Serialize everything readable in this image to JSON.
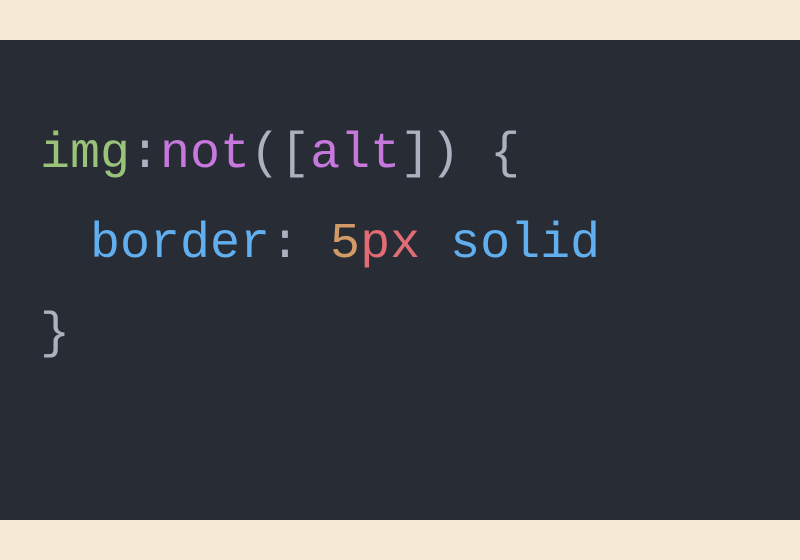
{
  "code": {
    "line1": {
      "selector_tag": "img",
      "colon": ":",
      "pseudo": "not",
      "paren_open": "(",
      "bracket_open": "[",
      "attr": "alt",
      "bracket_close": "]",
      "paren_close": ")",
      "space_brace": " {",
      "brace_open": "{"
    },
    "line2": {
      "property": "border",
      "colon_space": ": ",
      "number": "5",
      "unit": "px",
      "space": " ",
      "keyword": "solid"
    },
    "line3": {
      "brace_close": "}"
    }
  }
}
